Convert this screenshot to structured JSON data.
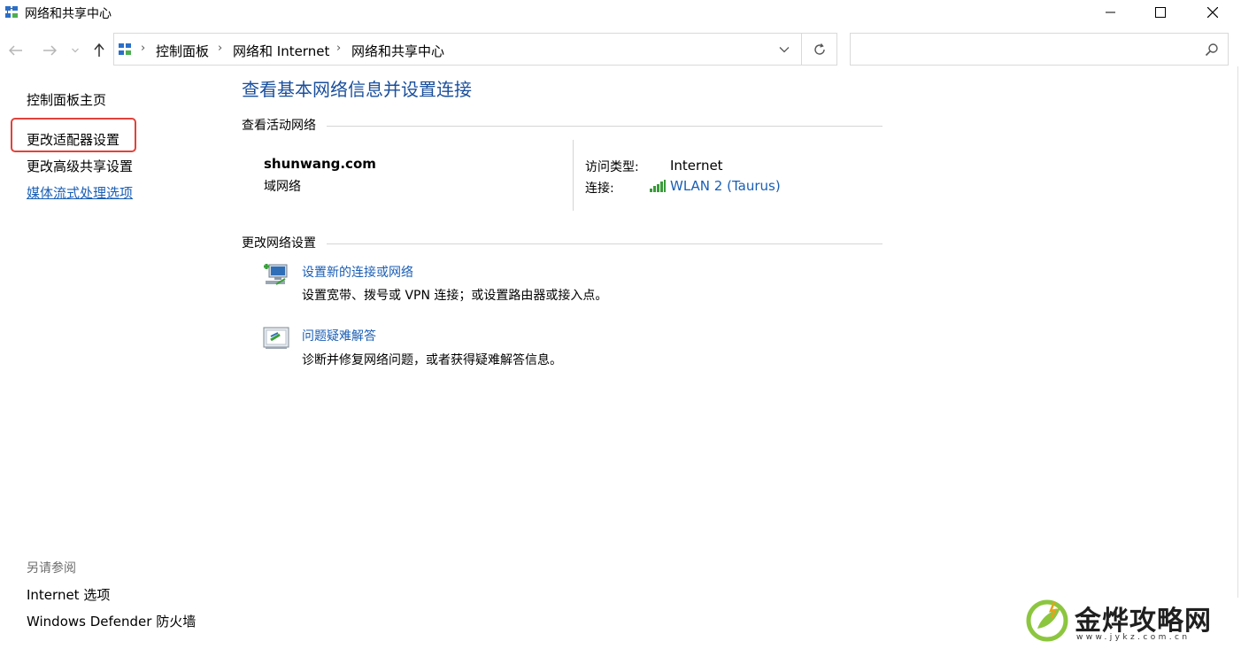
{
  "window": {
    "title": "网络和共享中心"
  },
  "address": {
    "crumbs": [
      "控制面板",
      "网络和 Internet",
      "网络和共享中心"
    ],
    "search_placeholder": ""
  },
  "sidebar": {
    "home": "控制面板主页",
    "adapter": "更改适配器设置",
    "sharing": "更改高级共享设置",
    "media": "媒体流式处理选项",
    "see_also": "另请参阅",
    "internet_options": "Internet 选项",
    "firewall": "Windows Defender 防火墙"
  },
  "main": {
    "title": "查看基本网络信息并设置连接",
    "active_section": "查看活动网络",
    "network": {
      "name": "shunwang.com",
      "type": "域网络",
      "access_label": "访问类型:",
      "access_value": "Internet",
      "connection_label": "连接:",
      "connection_value": "WLAN 2 (Taurus)"
    },
    "change_section": "更改网络设置",
    "tasks": [
      {
        "link": "设置新的连接或网络",
        "desc": "设置宽带、拨号或 VPN 连接；或设置路由器或接入点。"
      },
      {
        "link": "问题疑难解答",
        "desc": "诊断并修复网络问题，或者获得疑难解答信息。"
      }
    ]
  },
  "watermark": {
    "name": "金烨攻略网",
    "url": "www.jykz.com.cn"
  },
  "colors": {
    "link": "#1a5eb5",
    "title": "#1a4f9c",
    "highlight": "#e0433b"
  }
}
